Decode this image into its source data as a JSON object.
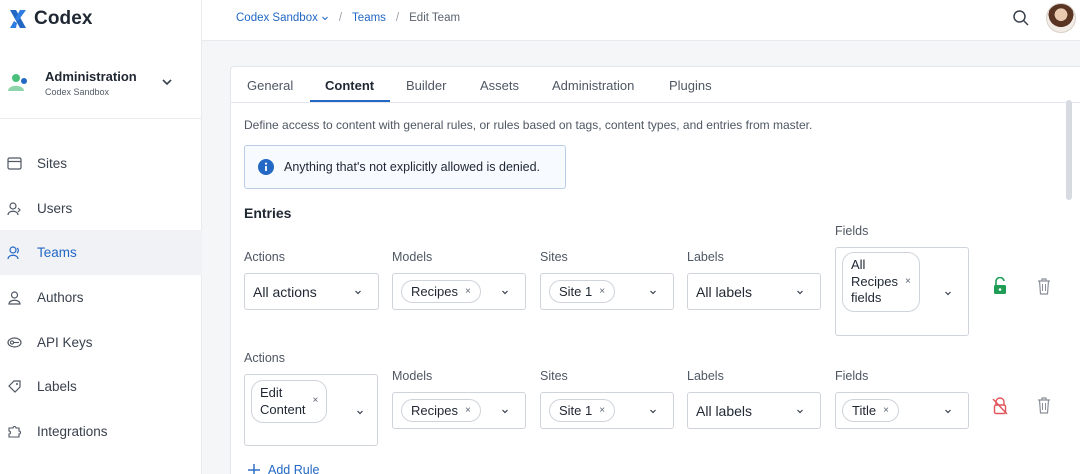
{
  "brand": {
    "name": "Codex",
    "accent": "#2268c4"
  },
  "org": {
    "title": "Administration",
    "subtitle": "Codex Sandbox"
  },
  "nav": [
    {
      "label": "Sites",
      "icon": "sites-icon"
    },
    {
      "label": "Users",
      "icon": "users-icon"
    },
    {
      "label": "Teams",
      "icon": "teams-icon",
      "active": true
    },
    {
      "label": "Authors",
      "icon": "authors-icon"
    },
    {
      "label": "API Keys",
      "icon": "api-keys-icon"
    },
    {
      "label": "Labels",
      "icon": "labels-icon"
    },
    {
      "label": "Integrations",
      "icon": "integrations-icon"
    }
  ],
  "breadcrumb": {
    "workspace": "Codex Sandbox",
    "section": "Teams",
    "current": "Edit Team",
    "separator": "/"
  },
  "tabs": [
    "General",
    "Content",
    "Builder",
    "Assets",
    "Administration",
    "Plugins"
  ],
  "active_tab": "Content",
  "description": "Define access to content with general rules, or rules based on tags, content types, and entries from master.",
  "notice": "Anything that's not explicitly allowed is denied.",
  "entries": {
    "title": "Entries",
    "labels": {
      "actions": "Actions",
      "models": "Models",
      "sites": "Sites",
      "labels": "Labels",
      "fields": "Fields"
    },
    "rules": [
      {
        "actions": "All actions",
        "models": "Recipes",
        "sites": "Site 1",
        "labels": "All labels",
        "fields_line1": "All",
        "fields_line2": "Recipes",
        "fields_line3": "fields",
        "lock": "unlocked",
        "lock_color": "#1f9d55"
      },
      {
        "actions_line1": "Edit",
        "actions_line2": "Content",
        "models": "Recipes",
        "sites": "Site 1",
        "labels": "All labels",
        "fields": "Title",
        "lock": "locked",
        "lock_color": "#e0545a"
      }
    ],
    "add_rule": "Add Rule"
  },
  "chip_remove": "×"
}
